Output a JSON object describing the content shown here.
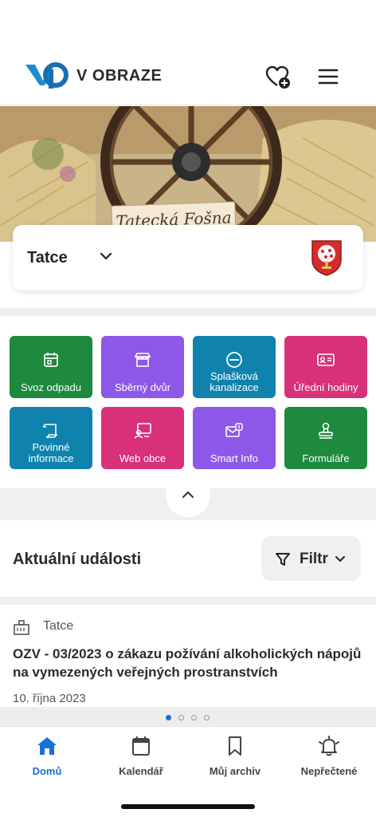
{
  "header": {
    "brand": "V OBRAZE",
    "icons": {
      "logo": "vp-logo",
      "favorite": "heart-plus-icon",
      "menu": "hamburger-menu-icon"
    }
  },
  "hero": {
    "sign_text": "Tatecká Fošna"
  },
  "town": {
    "name": "Tatce",
    "icon": "chevron-down-icon"
  },
  "tiles": [
    {
      "label": "Svoz odpadu",
      "color": "#1d8a3e",
      "icon": "calendar-icon"
    },
    {
      "label": "Sběrný dvůr",
      "color": "#8d58e8",
      "icon": "store-icon"
    },
    {
      "label": "Splašková kanalizace",
      "color": "#0f83ad",
      "icon": "no-entry-icon"
    },
    {
      "label": "Úřední hodiny",
      "color": "#d8317a",
      "icon": "id-card-icon"
    },
    {
      "label": "Povinné informace",
      "color": "#0f83ad",
      "icon": "scroll-icon"
    },
    {
      "label": "Web obce",
      "color": "#d8317a",
      "icon": "web-user-icon"
    },
    {
      "label": "Smart Info",
      "color": "#8d58e8",
      "icon": "mail-info-icon"
    },
    {
      "label": "Formuláře",
      "color": "#1d8a3e",
      "icon": "stamp-icon"
    }
  ],
  "events": {
    "title": "Aktuální události",
    "filter_label": "Filtr",
    "item": {
      "source": "Tatce",
      "title": "OZV - 03/2023 o zákazu požívání alkoholických nápojů na vymezených veřejných prostranstvích",
      "date": "10. října 2023"
    },
    "pager": {
      "count": 4,
      "active": 0
    }
  },
  "bottom_nav": [
    {
      "label": "Domů",
      "icon": "home-icon",
      "active": true
    },
    {
      "label": "Kalendář",
      "icon": "calendar-icon",
      "active": false
    },
    {
      "label": "Můj archiv",
      "icon": "bookmark-icon",
      "active": false
    },
    {
      "label": "Nepřečtené",
      "icon": "bell-icon",
      "active": false
    }
  ],
  "colors": {
    "accent": "#1a6fd8",
    "brand_blue": "#1d6fbf"
  }
}
